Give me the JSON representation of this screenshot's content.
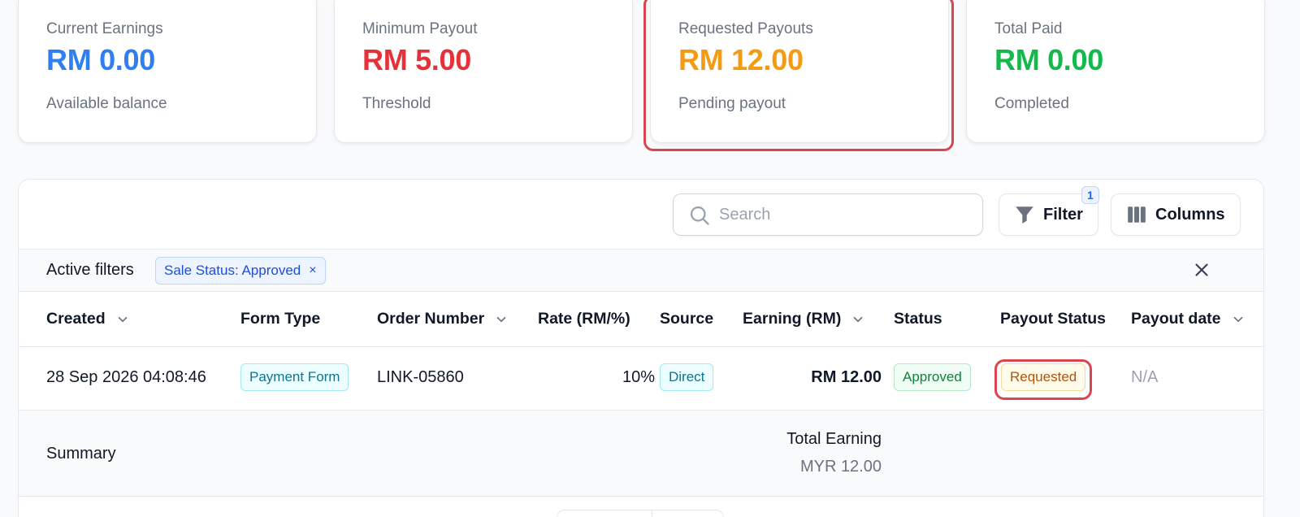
{
  "stats": [
    {
      "label": "Current Earnings",
      "value": "RM 0.00",
      "sub": "Available balance",
      "color": "#2f7ff0"
    },
    {
      "label": "Minimum Payout",
      "value": "RM 5.00",
      "sub": "Threshold",
      "color": "#e53239"
    },
    {
      "label": "Requested Payouts",
      "value": "RM 12.00",
      "sub": "Pending payout",
      "color": "#f39b12"
    },
    {
      "label": "Total Paid",
      "value": "RM 0.00",
      "sub": "Completed",
      "color": "#14b84b"
    }
  ],
  "toolbar": {
    "search_placeholder": "Search",
    "filter_label": "Filter",
    "filter_count": "1",
    "columns_label": "Columns"
  },
  "filters": {
    "label": "Active filters",
    "chip": "Sale Status: Approved",
    "chip_remove": "×"
  },
  "table": {
    "headers": [
      "Created",
      "Form Type",
      "Order Number",
      "Rate (RM/%)",
      "Source",
      "Earning (RM)",
      "Status",
      "Payout Status",
      "Payout date"
    ],
    "row": {
      "created": "28 Sep 2026 04:08:46",
      "form_type": "Payment Form",
      "order_number": "LINK-05860",
      "rate": "10%",
      "source": "Direct",
      "earning": "RM 12.00",
      "status": "Approved",
      "payout_status": "Requested",
      "payout_date": "N/A"
    }
  },
  "summary": {
    "label": "Summary",
    "total_label": "Total Earning",
    "total_value": "MYR 12.00"
  }
}
